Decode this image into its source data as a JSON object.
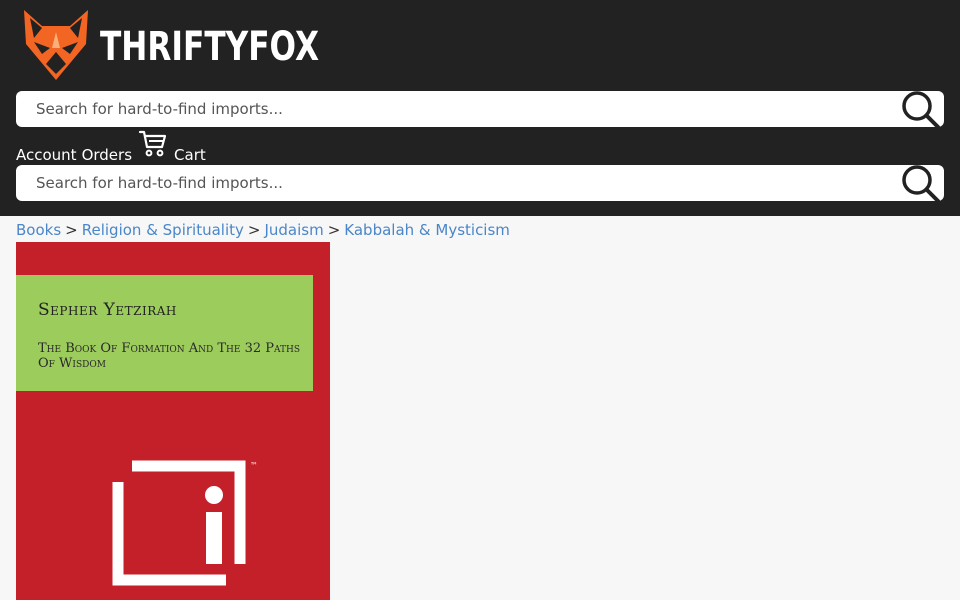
{
  "brand": {
    "name": "THRIFTYFOX",
    "logo_icon": "fox-head-icon"
  },
  "search": {
    "placeholder": "Search for hard-to-find imports...",
    "icon": "search-icon"
  },
  "nav": {
    "account": "Account",
    "orders": "Orders",
    "cart": "Cart",
    "cart_icon": "cart-icon"
  },
  "breadcrumb": {
    "items": [
      "Books",
      "Religion & Spirituality",
      "Judaism",
      "Kabbalah & Mysticism"
    ],
    "separator": ">"
  },
  "product": {
    "cover_title": "Sepher Yetzirah",
    "cover_subtitle": "The Book Of Formation And The 32 Paths Of Wisdom",
    "trademark": "™",
    "colors": {
      "cover": "#c4202a",
      "panel": "#9ccc5c"
    }
  },
  "colors": {
    "header": "#222222",
    "link": "#4a86c8",
    "fox": "#f26522"
  }
}
